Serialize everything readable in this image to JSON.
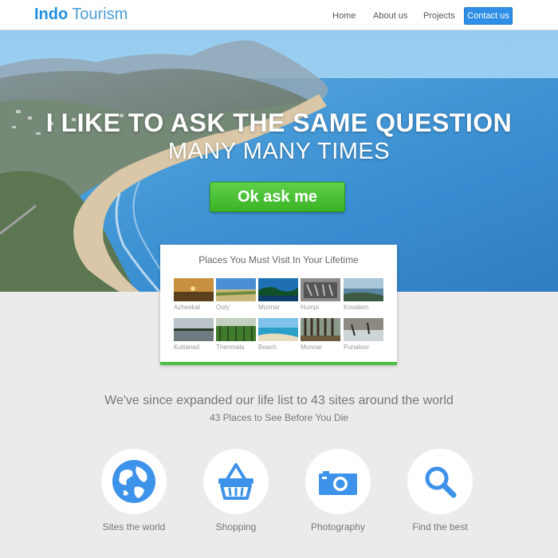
{
  "header": {
    "logo_strong": "Indo",
    "logo_light": "Tourism",
    "nav": {
      "home": "Home",
      "about": "About us",
      "projects": "Projects",
      "contact": "Contact us"
    }
  },
  "hero": {
    "title": "I LIKE TO ASK THE SAME QUESTION",
    "subtitle": "MANY MANY TIMES",
    "cta_label": "Ok ask me"
  },
  "places_card": {
    "title": "Places You Must Visit In Your Lifetime",
    "places": [
      {
        "label": "Azheekal"
      },
      {
        "label": "Ooty"
      },
      {
        "label": "Munnar"
      },
      {
        "label": "Humpi"
      },
      {
        "label": "Kovalam"
      },
      {
        "label": "Kuttanad"
      },
      {
        "label": "Thenmala"
      },
      {
        "label": "Beach"
      },
      {
        "label": "Munnar"
      },
      {
        "label": "Punaloor"
      }
    ]
  },
  "intro": {
    "tagline": "We've since expanded our life list to 43 sites around the world",
    "subtagline": "43 Places to See Before You Die"
  },
  "features": [
    {
      "label": "Sites the world",
      "icon": "globe-icon"
    },
    {
      "label": "Shopping",
      "icon": "basket-icon"
    },
    {
      "label": "Photography",
      "icon": "camera-icon"
    },
    {
      "label": "Find the best",
      "icon": "search-icon"
    }
  ],
  "colors": {
    "brand": "#1f8ee0",
    "accent_blue": "#2f8fe6",
    "cta_green": "#3ab424",
    "card_border_green": "#4dbf43",
    "icon_blue": "#3d92ea",
    "background": "#ebebeb"
  }
}
